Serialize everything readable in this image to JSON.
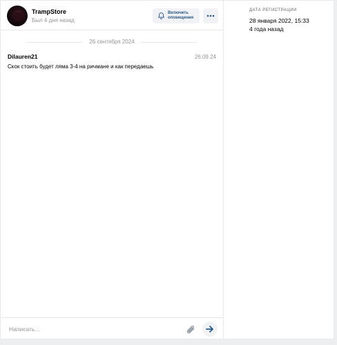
{
  "header": {
    "user_name": "TrampStore",
    "user_status": "Был 4 дня назад",
    "notify_label": "Включить оповещения",
    "icons": {
      "notify": "bell-icon",
      "more": "more-dots-icon",
      "avatar": "avatar-image"
    }
  },
  "messages": {
    "date_divider": "26 сентября 2024",
    "items": [
      {
        "author": "Dilauren21",
        "time": "26.09.24",
        "text": "Скок стоить будет ляма 3-4 на ричмане и как передаешь"
      }
    ]
  },
  "composer": {
    "placeholder": "Написать...",
    "icons": {
      "attach": "paperclip-icon",
      "send": "arrow-right-icon"
    }
  },
  "info": {
    "caption": "ДАТА РЕГИСТРАЦИИ",
    "date": "28 января 2022, 15:33",
    "ago": "4 года назад"
  },
  "colors": {
    "accent": "#2a5885",
    "muted": "#939393",
    "border": "#e7e8ec",
    "button_bg": "#f0f2f5"
  }
}
